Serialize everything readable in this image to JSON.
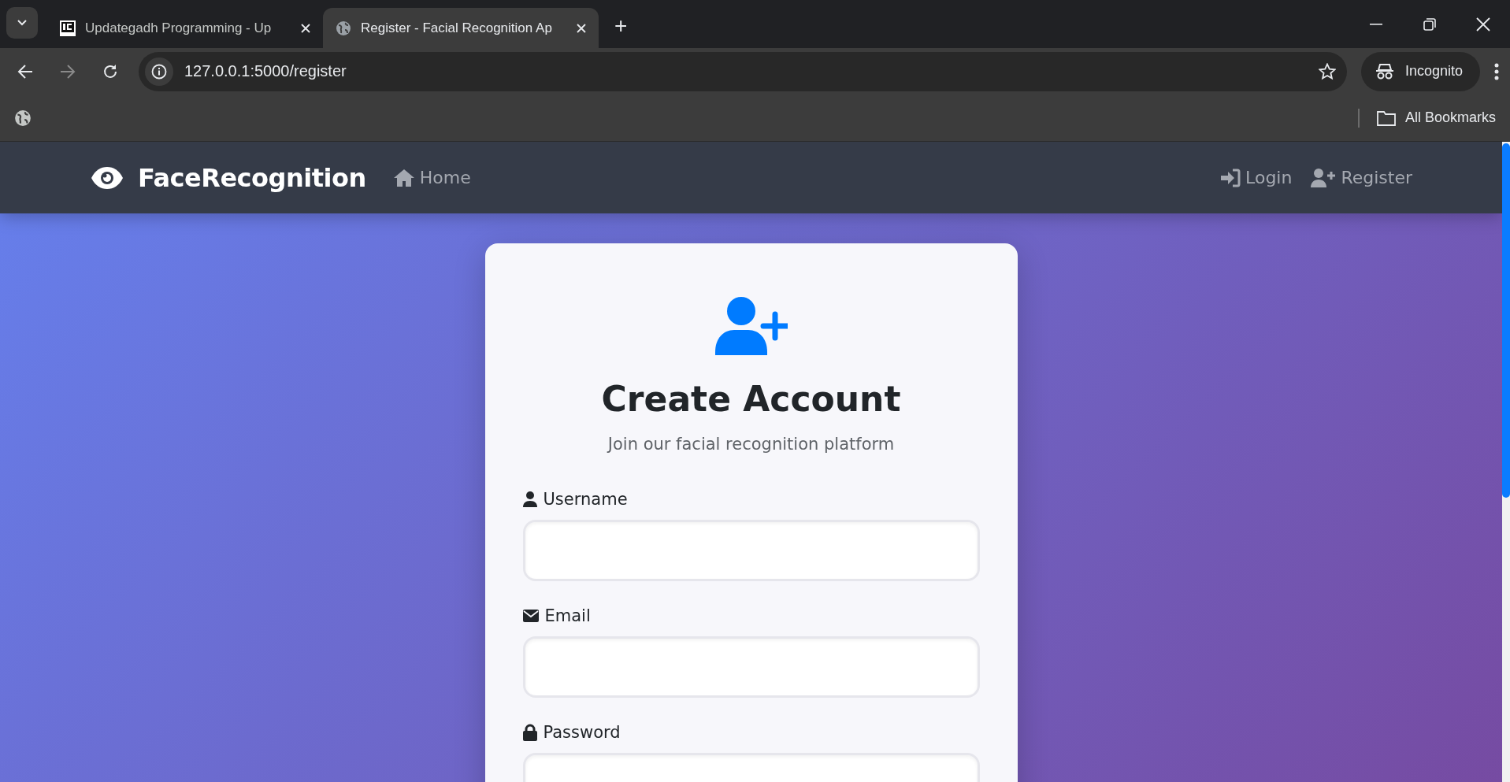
{
  "browser": {
    "tabs": [
      {
        "title": "Updategadh Programming - Up",
        "kind": "logo",
        "selected": false
      },
      {
        "title": "Register - Facial Recognition Ap",
        "kind": "globe",
        "selected": true
      }
    ],
    "new_tab_label": "+",
    "address": "127.0.0.1:5000/register",
    "profile": "Incognito",
    "bookmarks_label": "All Bookmarks"
  },
  "navbar": {
    "brand": "FaceRecognition",
    "left_links": [
      {
        "label": "Home",
        "kind": "home"
      }
    ],
    "right_links": [
      {
        "label": "Login",
        "kind": "login"
      },
      {
        "label": "Register",
        "kind": "register"
      }
    ]
  },
  "card": {
    "title": "Create Account",
    "subtitle": "Join our facial recognition platform",
    "fields": [
      {
        "label": "Username",
        "kind": "user"
      },
      {
        "label": "Email",
        "kind": "email"
      },
      {
        "label": "Password",
        "kind": "password"
      }
    ]
  }
}
